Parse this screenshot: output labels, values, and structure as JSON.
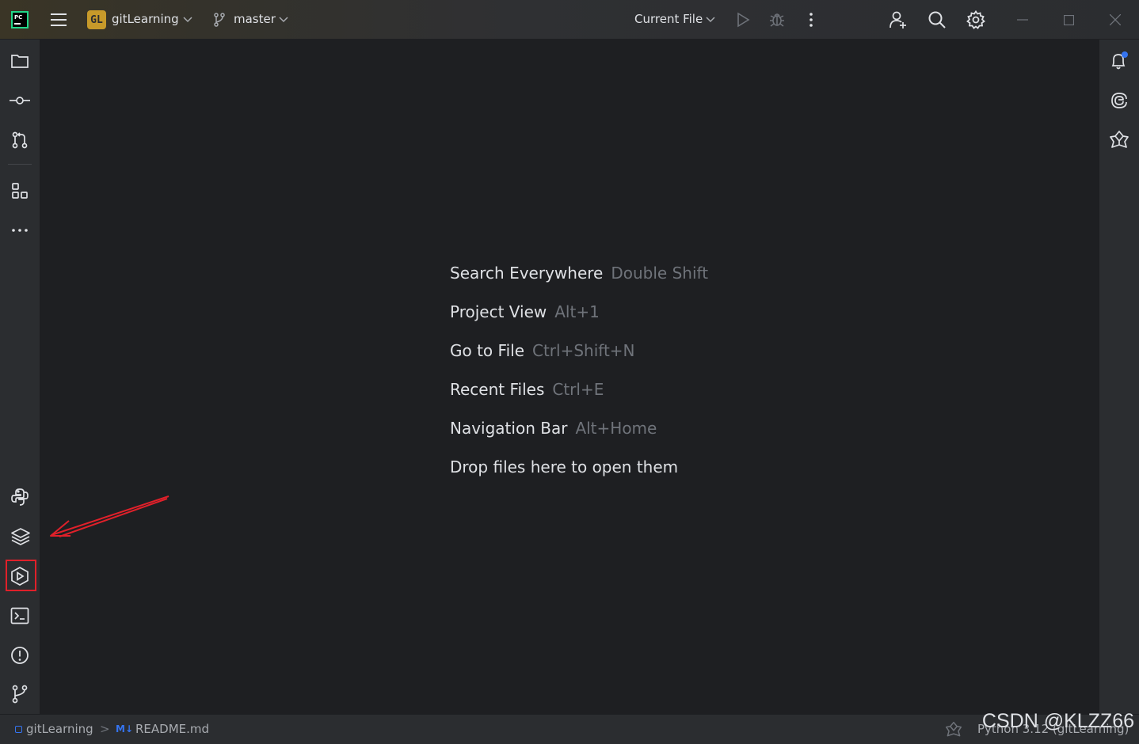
{
  "app": {
    "logo": "PC"
  },
  "titlebar": {
    "project_badge": "GL",
    "project_name": "gitLearning",
    "branch": "master",
    "run_config": "Current File"
  },
  "left_toolbar": {
    "top_icons": [
      "folder-icon",
      "commit-icon",
      "pull-requests-icon",
      "structure-icon",
      "more-icon"
    ],
    "bottom_icons": [
      "python-packages-icon",
      "layers-icon",
      "services-icon",
      "terminal-icon",
      "problems-icon",
      "git-icon"
    ],
    "highlighted": "layers-icon"
  },
  "right_toolbar": {
    "icons": [
      "notifications-icon",
      "ai-assistant-icon",
      "copilot-icon"
    ]
  },
  "editor": {
    "hints": [
      {
        "action": "Search Everywhere",
        "shortcut": "Double Shift"
      },
      {
        "action": "Project View",
        "shortcut": "Alt+1"
      },
      {
        "action": "Go to File",
        "shortcut": "Ctrl+Shift+N"
      },
      {
        "action": "Recent Files",
        "shortcut": "Ctrl+E"
      },
      {
        "action": "Navigation Bar",
        "shortcut": "Alt+Home"
      },
      {
        "action": "Drop files here to open them",
        "shortcut": ""
      }
    ]
  },
  "statusbar": {
    "breadcrumb_project": "gitLearning",
    "breadcrumb_sep": ">",
    "file_type_badge": "M↓",
    "file_name": "README.md",
    "interpreter": "Python 3.12 (gitLearning)"
  },
  "watermark": "CSDN @KLZZ66",
  "colors": {
    "accent_blue": "#3574f0",
    "annotation_red": "#e0202a",
    "badge_gold": "#c79a2a"
  }
}
